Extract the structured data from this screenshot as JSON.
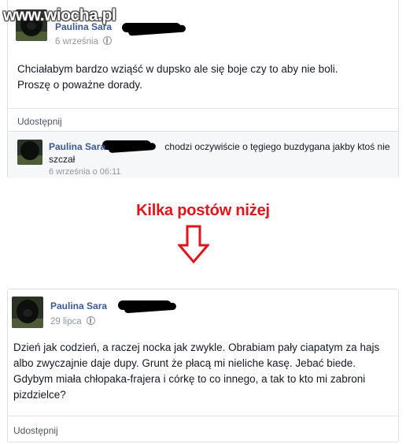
{
  "watermark": "www.wiocha.pl",
  "post1": {
    "author": "Paulina Sara",
    "date": "6 września",
    "text_line1": "Chciałabym bardzo wziąść w dupsko ale się boje czy to aby nie boli.",
    "text_line2": "Proszę o poważne dorady.",
    "share_label": "Udostępnij",
    "comment": {
      "author": "Paulina Sara",
      "text_line1": "chodzi oczywiście o tęgiego buzdygana jakby ktoś nie",
      "text_line2": "szczał",
      "date": "6 września o 06:11"
    }
  },
  "headline": "Kilka postów niżej",
  "arrow_icon": "down-arrow-icon",
  "post2": {
    "author": "Paulina Sara",
    "date": "29 lipca",
    "text_lines": [
      "Dzień jak codzień, a raczej nocka jak zwykle. Obrabiam pały ciapatym za hajs",
      "albo zwyczajnie daje dupy. Grunt że płacą mi nieliche kasę. Jebać biede.",
      "Gdybym miała chłopaka-frajera i córkę to co innego, a tak to kto mi zabroni",
      "pizdzielce?"
    ],
    "share_label": "Udostępnij"
  },
  "colors": {
    "link": "#3b5998",
    "meta": "#9197a3",
    "headline": "#e2141b"
  }
}
